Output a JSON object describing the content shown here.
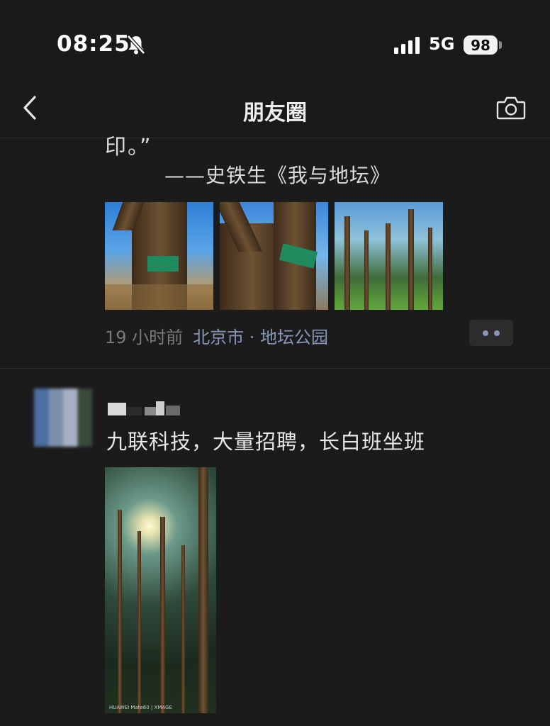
{
  "status_bar": {
    "time": "08:25",
    "network": "5G",
    "battery": "98",
    "silent_icon": "bell-slash-icon",
    "signal_icon": "signal-bars-icon"
  },
  "header": {
    "title": "朋友圈",
    "back_icon": "chevron-left-icon",
    "camera_icon": "camera-icon"
  },
  "post1": {
    "text_tail": "印。”",
    "quote_source": "——史铁生《我与地坛》",
    "images": [
      "tree-with-tag-photo",
      "forked-tree-with-tag-photo",
      "park-trees-photo"
    ],
    "time": "19 小时前",
    "location": "北京市 · 地坛公园"
  },
  "post2": {
    "text": "九联科技，大量招聘，长白班坐班",
    "images": [
      "forest-sunburst-photo"
    ],
    "image_watermark": "HUAWEI Mate60 | XMAGE"
  },
  "colors": {
    "background": "#1b1b1b",
    "link": "#8797b8",
    "time_gray": "#7b7b7b"
  }
}
